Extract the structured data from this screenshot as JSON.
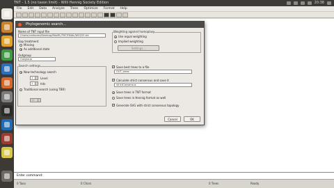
{
  "topbar": {
    "title": "TNT - 1.5 (no taxon limit) - Willi Hennig Society Edition",
    "clock": "20:38"
  },
  "app": {
    "menu": [
      "File",
      "Edit",
      "Data",
      "Analyze",
      "Trees",
      "Optimize",
      "Format",
      "Help"
    ],
    "command_label": "Enter command:",
    "status": [
      "0 Taxa",
      "0 Chars",
      "0 Trees",
      "Ready"
    ]
  },
  "dialog": {
    "title": "Phylogenomic search...",
    "input_file": {
      "label": "Name of TNT input file",
      "value": "/Users/carlborez/Desktop/RAxML/TNT/FINAL/WG225.tnt"
    },
    "gap": {
      "label": "Gap treatment",
      "missing": "Missing",
      "additional": "As additional state"
    },
    "outgroup": {
      "label": "Outgroup",
      "value": "Outgroup"
    },
    "search": {
      "label": "Search settings",
      "new_tech": "New technology search",
      "level_label": "Level",
      "level_value": "1",
      "hits_label": "hits",
      "hits_value": "1",
      "traditional": "Traditional search (using TBR)",
      "trad_value": "10"
    },
    "weighting": {
      "label": "Weighting against homoplasy",
      "equal": "Use equal weighting",
      "implied": "Implied weighting",
      "button": "Settings..."
    },
    "save_trees": {
      "label": "Save best trees to a file",
      "value": "OUT_trees"
    },
    "consensus": {
      "label": "Calculate strict consensus and save it",
      "value": "strictConsensus"
    },
    "tnt_format": "Save trees in TNT format",
    "hennig_format": "Save trees in Hennig format as well",
    "svg": "Generate SVG with strict consensus topology",
    "cancel": "Cancel",
    "ok": "OK"
  },
  "launcher_icons": [
    "dash-icon",
    "files-icon",
    "browser-icon",
    "calc-icon",
    "writer-icon",
    "software-icon",
    "settings-icon",
    "terminal-icon",
    "tnt-icon",
    "video-icon",
    "notes-icon",
    "trash-icon"
  ],
  "colors": {
    "accent": "#f05a2a",
    "panel": "#3d3a36",
    "dialog": "#ece9e4"
  }
}
